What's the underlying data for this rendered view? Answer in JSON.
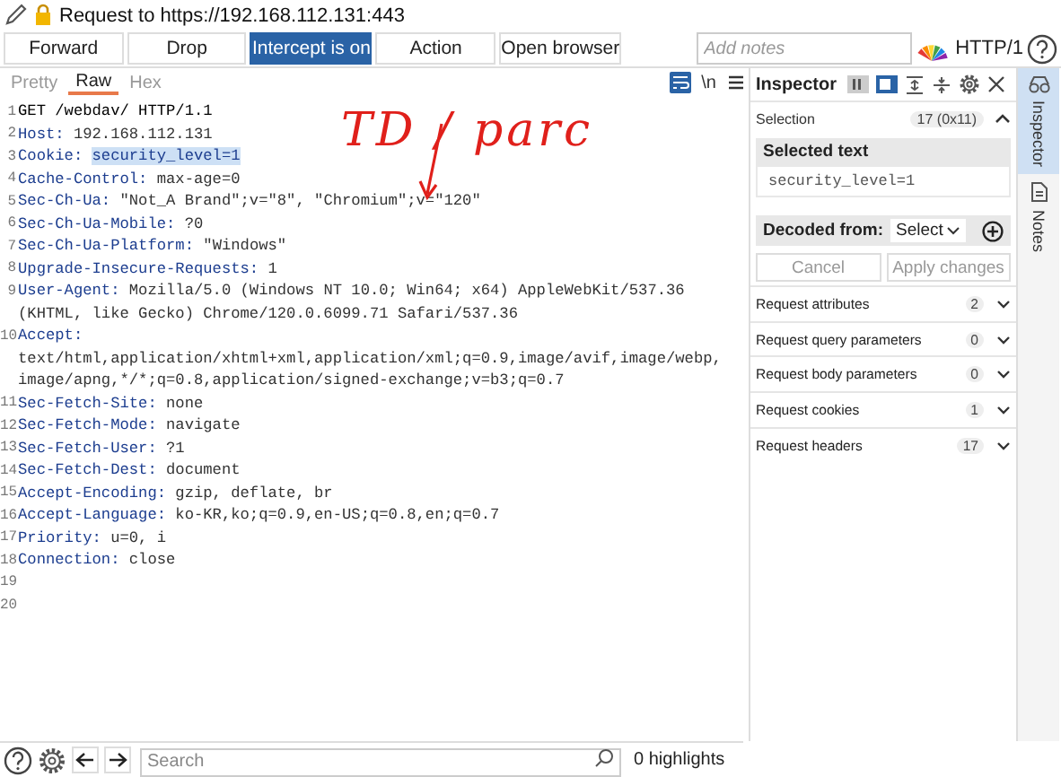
{
  "window": {
    "title": "Request to https://192.168.112.131:443"
  },
  "toolbar": {
    "buttons": [
      {
        "label": "Forward",
        "selected": false
      },
      {
        "label": "Drop",
        "selected": false
      },
      {
        "label": "Intercept is on",
        "selected": true
      },
      {
        "label": "Action",
        "selected": false
      },
      {
        "label": "Open browser",
        "selected": false
      }
    ],
    "notes": {
      "placeholder": "Add notes"
    },
    "protocol": "HTTP/1"
  },
  "editor": {
    "tabs": [
      {
        "label": "Pretty",
        "selected": false
      },
      {
        "label": "Raw",
        "selected": true
      },
      {
        "label": "Hex",
        "selected": false
      }
    ],
    "newline_toggle": "\\n",
    "lines": [
      {
        "number": "1",
        "kind": "request",
        "text": "GET /webdav/ HTTP/1.1",
        "selected": false
      },
      {
        "number": "2",
        "kind": "header",
        "name": "Host:",
        "value": "192.168.112.131",
        "selected": false
      },
      {
        "number": "3",
        "kind": "header",
        "name": "Cookie:",
        "value": "security_level=1",
        "selected": true
      },
      {
        "number": "4",
        "kind": "header",
        "name": "Cache-Control:",
        "value": "max-age=0",
        "selected": false
      },
      {
        "number": "5",
        "kind": "header",
        "name": "Sec-Ch-Ua:",
        "value": "\"Not_A Brand\";v=\"8\", \"Chromium\";v=\"120\"",
        "selected": false
      },
      {
        "number": "6",
        "kind": "header",
        "name": "Sec-Ch-Ua-Mobile:",
        "value": "?0",
        "selected": false
      },
      {
        "number": "7",
        "kind": "header",
        "name": "Sec-Ch-Ua-Platform:",
        "value": "\"Windows\"",
        "selected": false
      },
      {
        "number": "8",
        "kind": "header",
        "name": "Upgrade-Insecure-Requests:",
        "value": "1",
        "selected": false
      },
      {
        "number": "9",
        "kind": "header",
        "name": "User-Agent:",
        "value": "Mozilla/5.0 (Windows NT 10.0; Win64; x64) AppleWebKit/537.36",
        "continued": [
          "(KHTML, like Gecko) Chrome/120.0.6099.71 Safari/537.36"
        ],
        "selected": false
      },
      {
        "number": "10",
        "kind": "header",
        "name": "Accept:",
        "continued": [
          "text/html,application/xhtml+xml,application/xml;q=0.9,image/avif,image/webp,",
          "image/apng,*/*;q=0.8,application/signed-exchange;v=b3;q=0.7"
        ],
        "selected": false
      },
      {
        "number": "11",
        "kind": "header",
        "name": "Sec-Fetch-Site:",
        "value": "none",
        "selected": false
      },
      {
        "number": "12",
        "kind": "header",
        "name": "Sec-Fetch-Mode:",
        "value": "navigate",
        "selected": false
      },
      {
        "number": "13",
        "kind": "header",
        "name": "Sec-Fetch-User:",
        "value": "?1",
        "selected": false
      },
      {
        "number": "14",
        "kind": "header",
        "name": "Sec-Fetch-Dest:",
        "value": "document",
        "selected": false
      },
      {
        "number": "15",
        "kind": "header",
        "name": "Accept-Encoding:",
        "value": "gzip, deflate, br",
        "selected": false
      },
      {
        "number": "16",
        "kind": "header",
        "name": "Accept-Language:",
        "value": "ko-KR,ko;q=0.9,en-US;q=0.8,en;q=0.7",
        "selected": false
      },
      {
        "number": "17",
        "kind": "header",
        "name": "Priority:",
        "value": "u=0, i",
        "selected": false
      },
      {
        "number": "18",
        "kind": "header",
        "name": "Connection:",
        "value": "close",
        "selected": false
      },
      {
        "number": "19",
        "kind": "empty",
        "selected": false
      },
      {
        "number": "20",
        "kind": "empty",
        "selected": false
      }
    ],
    "annotation": "TD / parc"
  },
  "inspector": {
    "title": "Inspector",
    "selection": {
      "label": "Selection",
      "count": "17 (0x11)",
      "expanded": true
    },
    "selected_text": {
      "title": "Selected text",
      "value": "security_level=1"
    },
    "decoded_from": {
      "label": "Decoded from:",
      "dropdown": "Select"
    },
    "buttons": [
      {
        "label": "Cancel",
        "disabled": true
      },
      {
        "label": "Apply changes",
        "disabled": true
      }
    ],
    "sections": [
      {
        "label": "Request attributes",
        "count": "2"
      },
      {
        "label": "Request query parameters",
        "count": "0"
      },
      {
        "label": "Request body parameters",
        "count": "0"
      },
      {
        "label": "Request cookies",
        "count": "1"
      },
      {
        "label": "Request headers",
        "count": "17"
      }
    ]
  },
  "side_tabs": [
    {
      "label": "Inspector",
      "selected": true
    },
    {
      "label": "Notes",
      "selected": false
    }
  ],
  "bottom_bar": {
    "search": {
      "placeholder": "Search"
    },
    "highlights": "0 highlights"
  }
}
